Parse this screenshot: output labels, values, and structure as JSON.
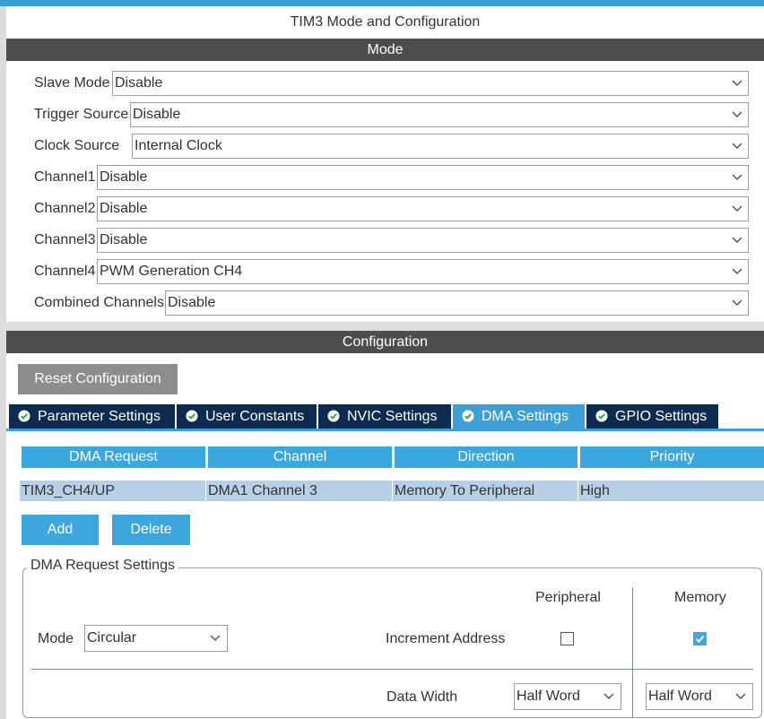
{
  "window": {
    "title": "TIM3 Mode and Configuration"
  },
  "mode_section": {
    "header": "Mode",
    "fields": [
      {
        "label": "Slave Mode",
        "value": "Disable"
      },
      {
        "label": "Trigger Source",
        "value": "Disable"
      },
      {
        "label": "Clock Source",
        "value": "Internal Clock"
      },
      {
        "label": "Channel1",
        "value": "Disable"
      },
      {
        "label": "Channel2",
        "value": "Disable"
      },
      {
        "label": "Channel3",
        "value": "Disable"
      },
      {
        "label": "Channel4",
        "value": "PWM Generation CH4"
      },
      {
        "label": "Combined Channels",
        "value": "Disable"
      }
    ]
  },
  "config_section": {
    "header": "Configuration",
    "reset_label": "Reset Configuration",
    "tabs": [
      {
        "label": "Parameter Settings",
        "icon": "check-circle-icon"
      },
      {
        "label": "User Constants",
        "icon": "check-circle-icon"
      },
      {
        "label": "NVIC Settings",
        "icon": "check-circle-icon"
      },
      {
        "label": "DMA Settings",
        "icon": "check-circle-icon",
        "active": true
      },
      {
        "label": "GPIO Settings",
        "icon": "check-circle-icon"
      }
    ]
  },
  "dma_table": {
    "columns": [
      "DMA Request",
      "Channel",
      "Direction",
      "Priority"
    ],
    "rows": [
      {
        "request": "TIM3_CH4/UP",
        "channel": "DMA1 Channel 3",
        "direction": "Memory To Peripheral",
        "priority": "High"
      }
    ]
  },
  "buttons": {
    "add": "Add",
    "delete": "Delete"
  },
  "dma_request_settings": {
    "legend": "DMA Request Settings",
    "peripheral_label": "Peripheral",
    "memory_label": "Memory",
    "mode_label": "Mode",
    "mode_value": "Circular",
    "increment_label": "Increment Address",
    "increment_peripheral": false,
    "increment_memory": true,
    "data_width_label": "Data Width",
    "data_width_peripheral": "Half Word",
    "data_width_memory": "Half Word"
  },
  "colors": {
    "accent": "#3ca7dd",
    "tab_dark": "#0d2b4e",
    "header_dark": "#4d4d4d",
    "row_selected": "#b8d0e6"
  }
}
